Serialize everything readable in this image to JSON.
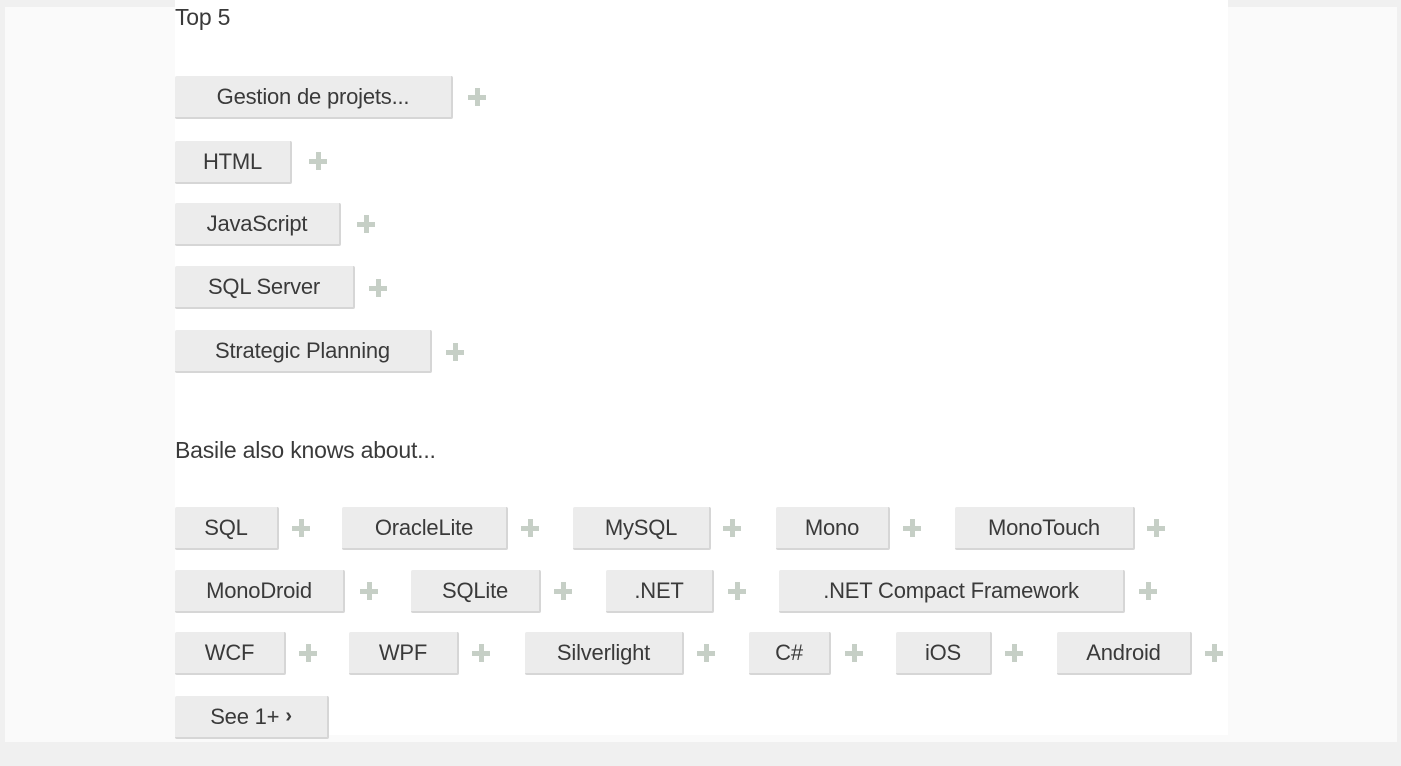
{
  "top_heading": "Top 5",
  "top_skills": [
    "Gestion de projets...",
    "HTML",
    "JavaScript",
    "SQL Server",
    "Strategic Planning"
  ],
  "also_heading": "Basile also knows about...",
  "also_skills": [
    "SQL",
    "OracleLite",
    "MySQL",
    "Mono",
    "MonoTouch",
    "MonoDroid",
    "SQLite",
    ".NET",
    ".NET Compact Framework",
    "WCF",
    "WPF",
    "Silverlight",
    "C#",
    "iOS",
    "Android"
  ],
  "see_more_label": "See 1+",
  "see_more_icon": "chevron-right-icon",
  "add_icon": "plus-icon",
  "colors": {
    "tag_background": "#ececec",
    "plus_icon": "#c6cfc6",
    "text": "#3a3a3a"
  }
}
